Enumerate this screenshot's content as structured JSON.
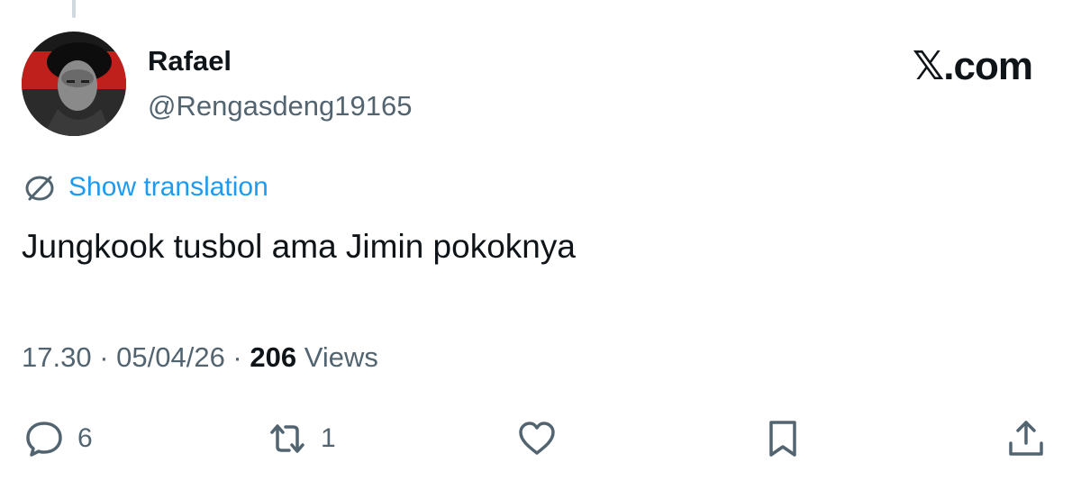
{
  "author": {
    "name": "Rafael",
    "handle": "@Rengasdeng19165"
  },
  "brand": "𝕏.com",
  "translation_label": "Show translation",
  "tweet_text": "Jungkook tusbol ama Jimin pokoknya",
  "meta": {
    "time": "17.30",
    "date": "05/04/26",
    "separator": " · ",
    "views_count": "206",
    "views_label": "Views"
  },
  "actions": {
    "replies": "6",
    "reposts": "1"
  },
  "icons": {
    "translate": "globe-slash-icon",
    "reply": "speech-bubble-icon",
    "repost": "repost-arrows-icon",
    "like": "heart-icon",
    "bookmark": "bookmark-icon",
    "share": "share-icon"
  },
  "colors": {
    "link": "#1d9bf0",
    "muted": "#536471",
    "text": "#0f1419",
    "thread_line": "#cfd9de"
  }
}
